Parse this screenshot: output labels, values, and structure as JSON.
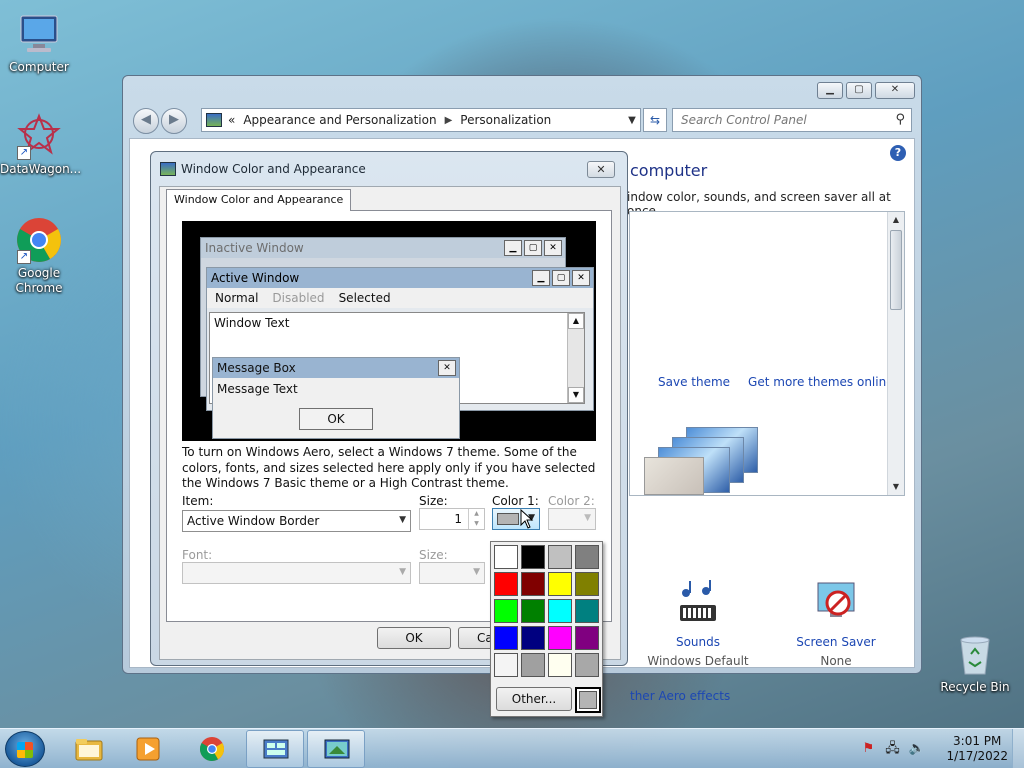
{
  "desktop": {
    "icons": [
      {
        "label": "Computer"
      },
      {
        "label": "DataWagon..."
      },
      {
        "label": "Google Chrome"
      },
      {
        "label": "Recycle Bin"
      }
    ]
  },
  "control_panel": {
    "breadcrumb_prefix": "«",
    "breadcrumb": [
      "Appearance and Personalization",
      "Personalization"
    ],
    "search_placeholder": "Search Control Panel",
    "heading_fragment": "computer",
    "subtitle_fragment": "indow color, sounds, and screen saver all at once.",
    "save_theme": "Save theme",
    "get_more_themes": "Get more themes online",
    "sounds_label": "Sounds",
    "sounds_value": "Windows Default",
    "screensaver_label": "Screen Saver",
    "screensaver_value": "None",
    "aero_link": "ther Aero effects",
    "help": "?"
  },
  "dialog": {
    "title": "Window Color and Appearance",
    "tab": "Window Color and Appearance",
    "preview": {
      "inactive_title": "Inactive Window",
      "active_title": "Active Window",
      "menu_normal": "Normal",
      "menu_disabled": "Disabled",
      "menu_selected": "Selected",
      "window_text": "Window Text",
      "msgbox_title": "Message Box",
      "msgbox_text": "Message Text",
      "ok": "OK"
    },
    "description": "To turn on Windows Aero, select a Windows 7 theme.  Some of the colors, fonts, and sizes selected here apply only if you have selected the Windows 7 Basic theme or a High Contrast theme.",
    "item_label": "Item:",
    "item_value": "Active Window Border",
    "size_label": "Size:",
    "size_value": "1",
    "color1_label": "Color 1:",
    "color2_label": "Color 2:",
    "font_label": "Font:",
    "font_size_label": "Size:",
    "ok_button": "OK",
    "cancel_button": "Ca"
  },
  "palette": {
    "colors": [
      "#ffffff",
      "#000000",
      "#c0c0c0",
      "#808080",
      "#ff0000",
      "#800000",
      "#ffff00",
      "#808000",
      "#00ff00",
      "#008000",
      "#00ffff",
      "#008080",
      "#0000ff",
      "#000080",
      "#ff00ff",
      "#800080",
      "#f4f4f4",
      "#a0a0a0",
      "#fffff0",
      "#a8a8a8"
    ],
    "selected_color": "#b4b4b4",
    "other_button": "Other..."
  },
  "taskbar": {
    "clock_time": "3:01 PM",
    "clock_date": "1/17/2022"
  }
}
